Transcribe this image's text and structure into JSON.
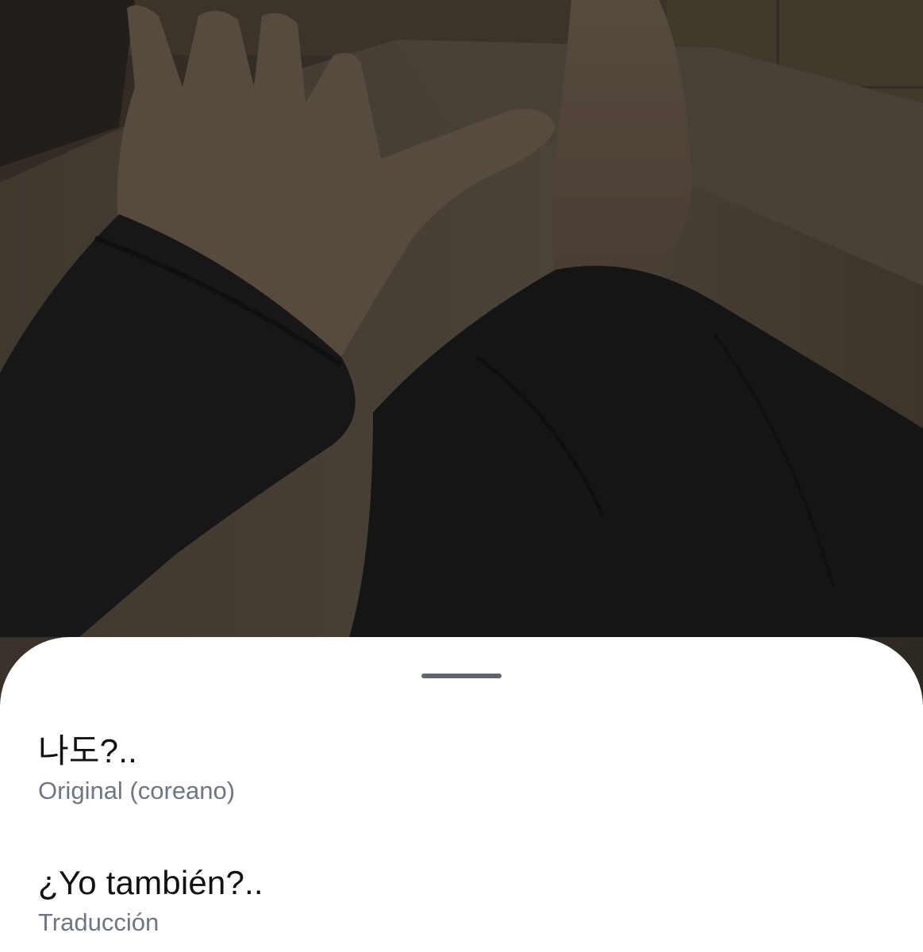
{
  "sheet": {
    "original": {
      "text": "나도?..",
      "label": "Original (coreano)"
    },
    "translation": {
      "text": "¿Yo también?..",
      "label": "Traducción"
    }
  }
}
